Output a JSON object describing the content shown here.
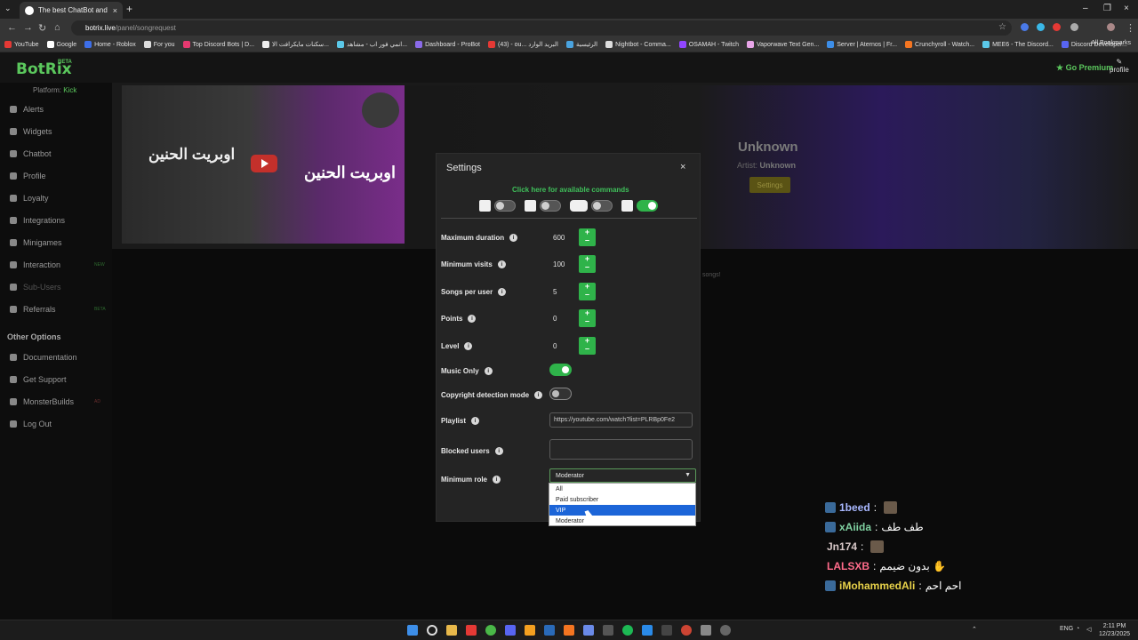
{
  "browser": {
    "tab_title": "The best ChatBot and Widgets",
    "new_tab": "+",
    "url_host": "botrix.live",
    "url_path": "/panel/songrequest",
    "bookmarks": [
      {
        "label": "YouTube",
        "color": "#e53935"
      },
      {
        "label": "Google",
        "color": "#ffffff"
      },
      {
        "label": "Home - Roblox",
        "color": "#3d6ee8"
      },
      {
        "label": "For you",
        "color": "#dddddd"
      },
      {
        "label": "Top Discord Bots | D...",
        "color": "#e53970"
      },
      {
        "label": "سكنات مايكرافت الا...",
        "color": "#eeeeee"
      },
      {
        "label": "انمي فور اب - مشاهد...",
        "color": "#5bc8e8"
      },
      {
        "label": "Dashboard - ProBot",
        "color": "#8a6ae8"
      },
      {
        "label": "(43) - ou... البريد الوارد",
        "color": "#e53935"
      },
      {
        "label": "الرئيسية",
        "color": "#4aa3df"
      },
      {
        "label": "Nightbot - Comma...",
        "color": "#dddddd"
      },
      {
        "label": "OSAMAH - Twitch",
        "color": "#9146ff"
      },
      {
        "label": "Vaporwave Text Gen...",
        "color": "#e8a5e8"
      },
      {
        "label": "Server | Aternos | Fr...",
        "color": "#3d8ee8"
      },
      {
        "label": "Crunchyroll - Watch...",
        "color": "#f47521"
      },
      {
        "label": "MEE6 - The Discord...",
        "color": "#5bc8e8"
      },
      {
        "label": "Discord Developer...",
        "color": "#5865f2"
      }
    ],
    "all_bookmarks": "All Bookmarks"
  },
  "site": {
    "logo": "BotRix",
    "beta": "BETA",
    "go_premium": "Go Premium",
    "profile": "profile"
  },
  "sidebar": {
    "platform_label": "Platform:",
    "platform_value": "Kick",
    "items": [
      {
        "label": "Alerts",
        "tag": ""
      },
      {
        "label": "Widgets",
        "tag": ""
      },
      {
        "label": "Chatbot",
        "tag": ""
      },
      {
        "label": "Profile",
        "tag": ""
      },
      {
        "label": "Loyalty",
        "tag": ""
      },
      {
        "label": "Integrations",
        "tag": ""
      },
      {
        "label": "Minigames",
        "tag": ""
      },
      {
        "label": "Interaction",
        "tag": "NEW"
      },
      {
        "label": "Sub-Users",
        "tag": ""
      },
      {
        "label": "Referrals",
        "tag": "BETA"
      }
    ],
    "other_options_heading": "Other Options",
    "other_items": [
      {
        "label": "Documentation",
        "tag": ""
      },
      {
        "label": "Get Support",
        "tag": ""
      },
      {
        "label": "MonsterBuilds",
        "tag": "AD"
      },
      {
        "label": "Log Out",
        "tag": ""
      }
    ]
  },
  "player": {
    "video_text_left": "اوبريت الحنين",
    "video_text_right": "اوبريت الحنين",
    "song_title": "Unknown",
    "artist_label": "Artist:",
    "artist_value": "Unknown",
    "settings_button": "Settings",
    "bg_note": "songs!"
  },
  "modal": {
    "title": "Settings",
    "close": "×",
    "commands_link": "Click here for available commands",
    "platforms": [
      {
        "name": "kick-bot",
        "enabled": false
      },
      {
        "name": "twitch",
        "enabled": false
      },
      {
        "name": "youtube",
        "enabled": false
      },
      {
        "name": "kick",
        "enabled": true
      }
    ],
    "fields": [
      {
        "label": "Maximum duration",
        "value": "600"
      },
      {
        "label": "Minimum visits",
        "value": "100"
      },
      {
        "label": "Songs per user",
        "value": "5"
      },
      {
        "label": "Points",
        "value": "0"
      },
      {
        "label": "Level",
        "value": "0"
      }
    ],
    "music_only_label": "Music Only",
    "music_only": true,
    "copyright_label": "Copyright detection mode",
    "copyright": false,
    "playlist_label": "Playlist",
    "playlist_value": "https://youtube.com/watch?list=PLRBp0Fe2",
    "blocked_label": "Blocked users",
    "blocked_value": "",
    "min_role_label": "Minimum role",
    "min_role_value": "Moderator",
    "role_options": [
      "All",
      "Paid subscriber",
      "VIP",
      "Moderator"
    ],
    "highlighted_option": "VIP"
  },
  "chat": [
    {
      "user": "1beed",
      "message": "",
      "color": "#a9b8ff",
      "has_emoji": true
    },
    {
      "user": "xAiida",
      "message": "طف طف",
      "color": "#7fd0a0",
      "has_emoji": false
    },
    {
      "user": "Jn174",
      "message": "",
      "color": "#d8c8c8",
      "has_emoji": true
    },
    {
      "user": "LALSXB",
      "message": "بدون ضيمم ✋",
      "color": "#ff6b8a",
      "has_emoji": false
    },
    {
      "user": "iMohammedAli",
      "message": "احم احم",
      "color": "#e8d24a",
      "has_emoji": false
    }
  ],
  "taskbar": {
    "lang": "ENG",
    "time": "2:11 PM",
    "date": "12/23/2025"
  }
}
